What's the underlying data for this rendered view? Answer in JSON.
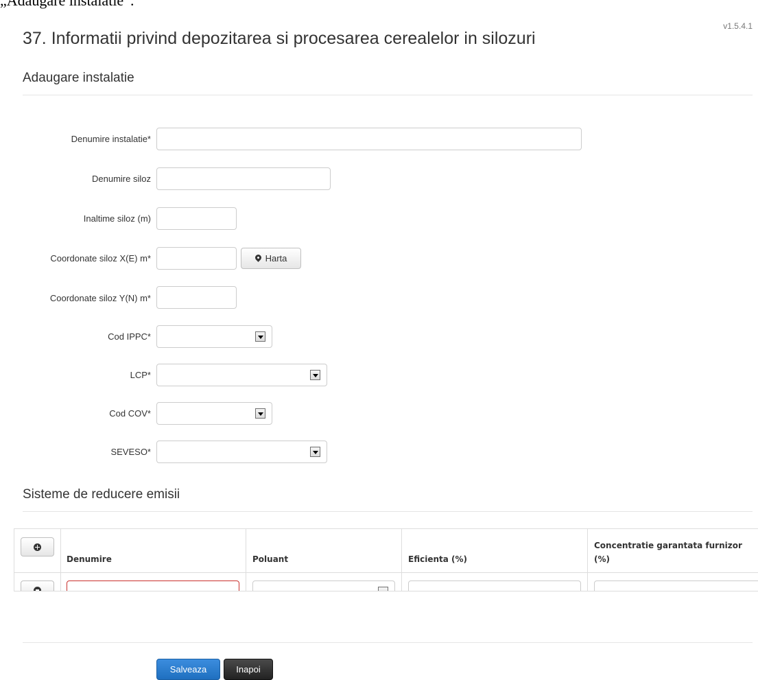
{
  "crop_text": "„Adaugare instalatie”.",
  "version": "v1.5.4.1",
  "page_title": "37. Informatii privind depozitarea si procesarea cerealelor in silozuri",
  "section_install": "Adaugare instalatie",
  "fields": {
    "denumire_instalatie": "Denumire instalatie*",
    "denumire_siloz": "Denumire siloz",
    "inaltime_siloz": "Inaltime siloz (m)",
    "coord_x": "Coordonate siloz X(E) m*",
    "coord_y": "Coordonate siloz Y(N) m*",
    "cod_ippc": "Cod IPPC*",
    "lcp": "LCP*",
    "cod_cov": "Cod COV*",
    "seveso": "SEVESO*"
  },
  "values": {
    "denumire_instalatie": "",
    "denumire_siloz": "",
    "inaltime_siloz": "",
    "coord_x": "",
    "coord_y": "",
    "cod_ippc": "",
    "lcp": "",
    "cod_cov": "",
    "seveso": "",
    "row_denumire": "",
    "row_poluant": "",
    "row_eficienta": "",
    "row_concentratie": ""
  },
  "harta_label": "Harta",
  "section_emisii": "Sisteme de reducere emisii",
  "table": {
    "headers": [
      "Denumire",
      "Poluant",
      "Eficienta (%)",
      "Concentratie garantata furnizor",
      "(%)"
    ]
  },
  "buttons": {
    "save": "Salveaza",
    "back": "Inapoi"
  },
  "icons": {
    "harta": "map-marker-icon",
    "add_row": "plus-circle-icon",
    "remove_row": "minus-circle-icon",
    "dropdown": "dropdown-arrow-icon"
  }
}
